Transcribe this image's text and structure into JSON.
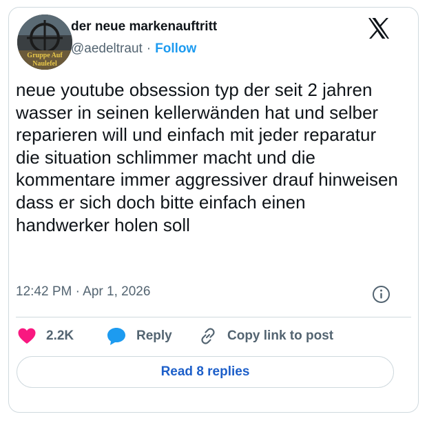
{
  "author": {
    "display_name": "der neue markenauftritt",
    "handle": "@aedeltraut",
    "separator": "·",
    "follow_label": "Follow",
    "avatar_text": "Gruppe Auf Naulefel"
  },
  "platform_icon": "x-logo-icon",
  "tweet": {
    "text": "neue youtube obsession typ der seit 2 jahren wasser in seinen kellerwänden hat und selber reparieren will und einfach mit jeder reparatur die situation schlimmer macht und die kommentare immer aggressiver drauf hinweisen dass er sich doch bitte einfach einen handwerker holen soll",
    "timestamp": "12:42 PM · Apr 1, 2026"
  },
  "actions": {
    "like_count": "2.2K",
    "reply_label": "Reply",
    "copy_label": "Copy link to post"
  },
  "read_replies_label": "Read 8 replies",
  "colors": {
    "accent": "#1d9bf0",
    "like": "#f91880",
    "reply_icon": "#1d9bf0",
    "muted": "#536471",
    "border": "#cfd9de"
  }
}
